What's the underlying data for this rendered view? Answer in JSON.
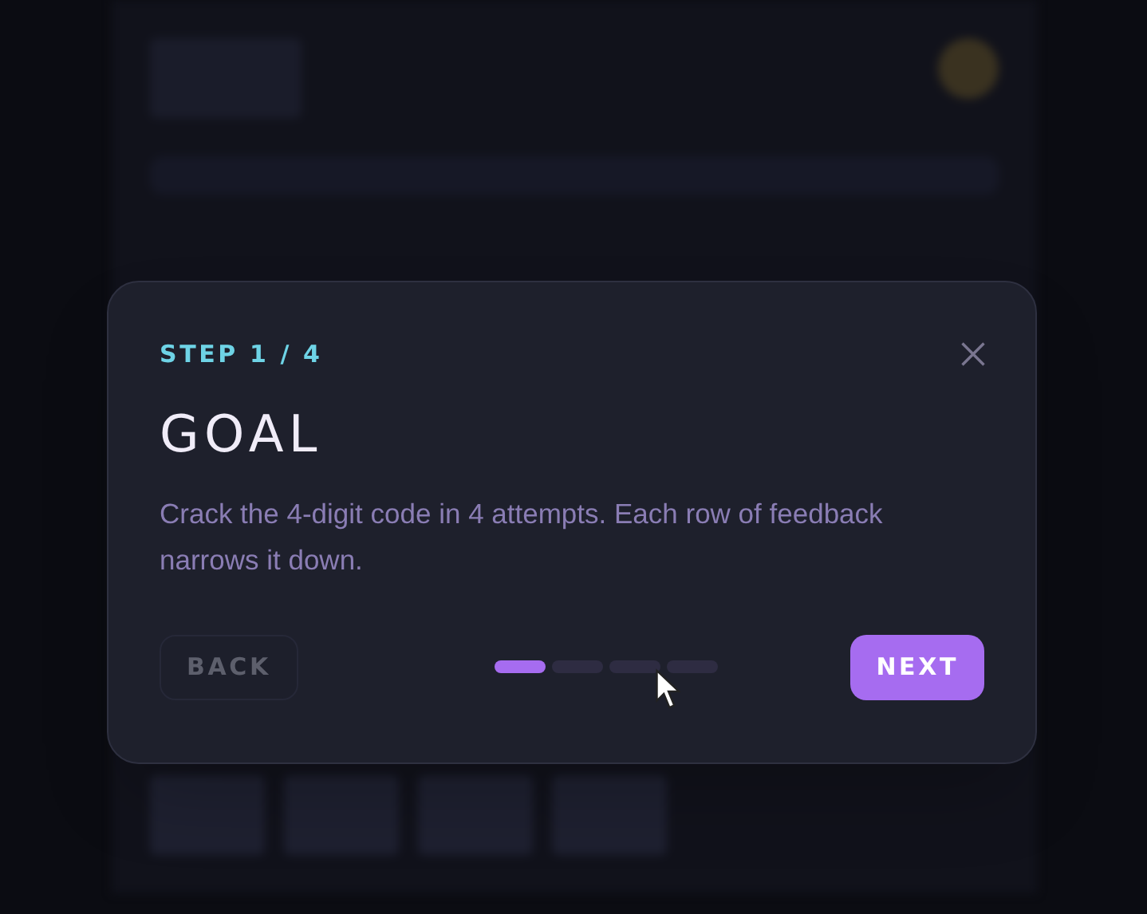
{
  "dialog": {
    "step_label": "STEP 1 / 4",
    "title": "GOAL",
    "body": "Crack the 4-digit code in 4 attempts. Each row of feedback narrows it down.",
    "back_button": {
      "label": "BACK",
      "disabled": true
    },
    "next_button": {
      "label": "NEXT",
      "disabled": false
    },
    "steps": [
      {
        "selected": true
      },
      {
        "selected": false
      },
      {
        "selected": false
      },
      {
        "selected": false
      }
    ]
  }
}
